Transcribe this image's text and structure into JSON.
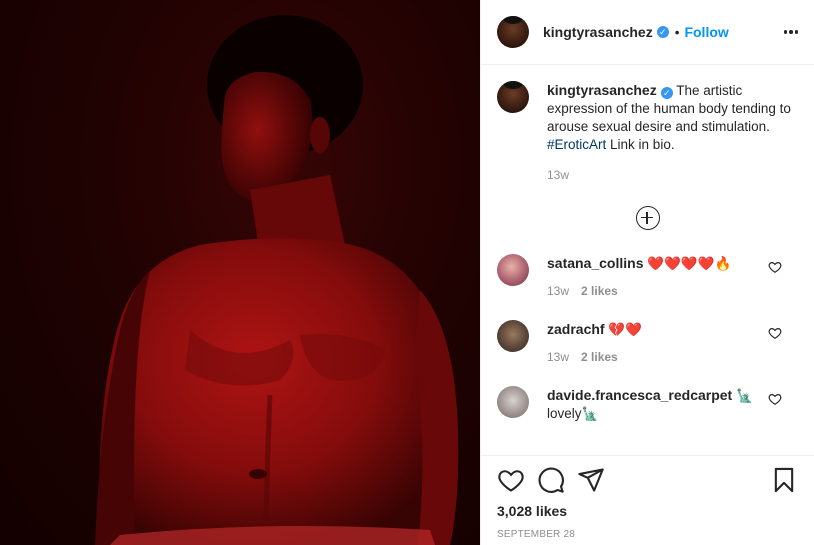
{
  "post": {
    "author": "kingtyrasanchez",
    "verified_mark": "✓",
    "dot": "•",
    "follow_label": "Follow",
    "caption_text": " The artistic expression of the human body tending to arouse sexual desire and stimulation. ",
    "caption_hashtag": "#EroticArt",
    "caption_tail": " Link in bio.",
    "caption_time": "13w",
    "likes": "3,028 likes",
    "date": "SEPTEMBER 28"
  },
  "comments": [
    {
      "user": "satana_collins",
      "text": "❤️❤️❤️❤️🔥",
      "time": "13w",
      "likes": "2 likes"
    },
    {
      "user": "zadrachf",
      "text": "💔❤️",
      "time": "13w",
      "likes": "2 likes"
    },
    {
      "user": "davide.francesca_redcarpet",
      "text": "🗽",
      "line2": "lovely🗽"
    }
  ],
  "icons": {
    "more": "more-options-icon",
    "load_more": "plus-circle-icon",
    "comment_like": "heart-outline-icon",
    "like": "heart-icon",
    "comment": "comment-bubble-icon",
    "share": "paper-plane-icon",
    "save": "bookmark-icon"
  },
  "colors": {
    "follow": "#0095f6",
    "verified": "#3897f0",
    "secondary_text": "#8e8e8e",
    "hashtag": "#00376b",
    "photo_bg": "#1a0202",
    "skin_red": "#a81212"
  }
}
